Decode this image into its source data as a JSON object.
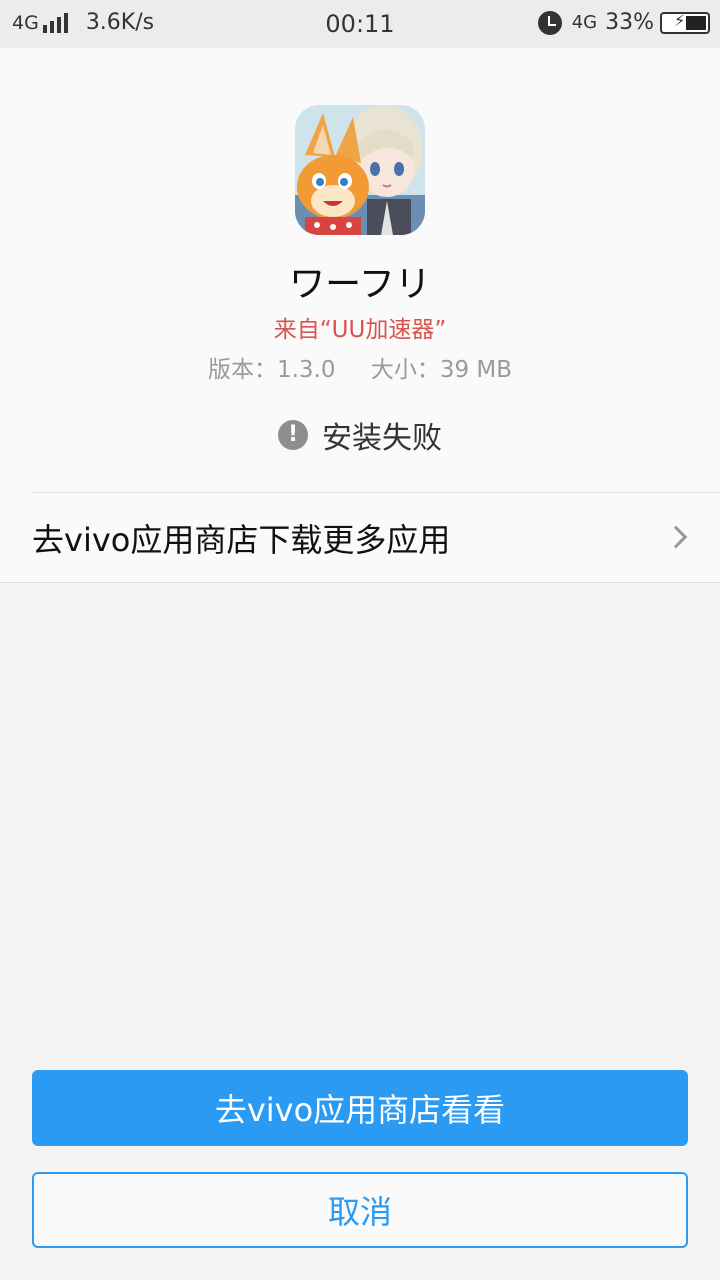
{
  "status_bar": {
    "network_left": "4G",
    "speed": "3.6K/s",
    "time": "00:11",
    "network_right": "4G",
    "battery_percent": "33%"
  },
  "app": {
    "name": "ワーフリ",
    "source": "来自“UU加速器”",
    "version": "版本：1.3.0",
    "size": "大小：39 MB",
    "install_status": "安装失败",
    "icon": "app-icon-character-art"
  },
  "store_link": {
    "label": "去vivo应用商店下载更多应用"
  },
  "buttons": {
    "primary": "去vivo应用商店看看",
    "cancel": "取消"
  },
  "colors": {
    "accent": "#2a9af3",
    "source_text": "#d9534f"
  }
}
